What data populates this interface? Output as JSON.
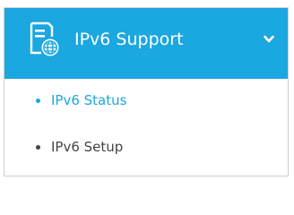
{
  "menu": {
    "header": {
      "title": "IPv6 Support",
      "icon": "network-globe-icon",
      "expand_icon": "chevron-down-icon",
      "background_color": "#1ba7e0",
      "text_color": "#ffffff"
    },
    "items": [
      {
        "label": "IPv6 Status",
        "active": true,
        "bullet_color": "#1ba7e0"
      },
      {
        "label": "IPv6 Setup",
        "active": false,
        "bullet_color": "#444444"
      }
    ]
  }
}
